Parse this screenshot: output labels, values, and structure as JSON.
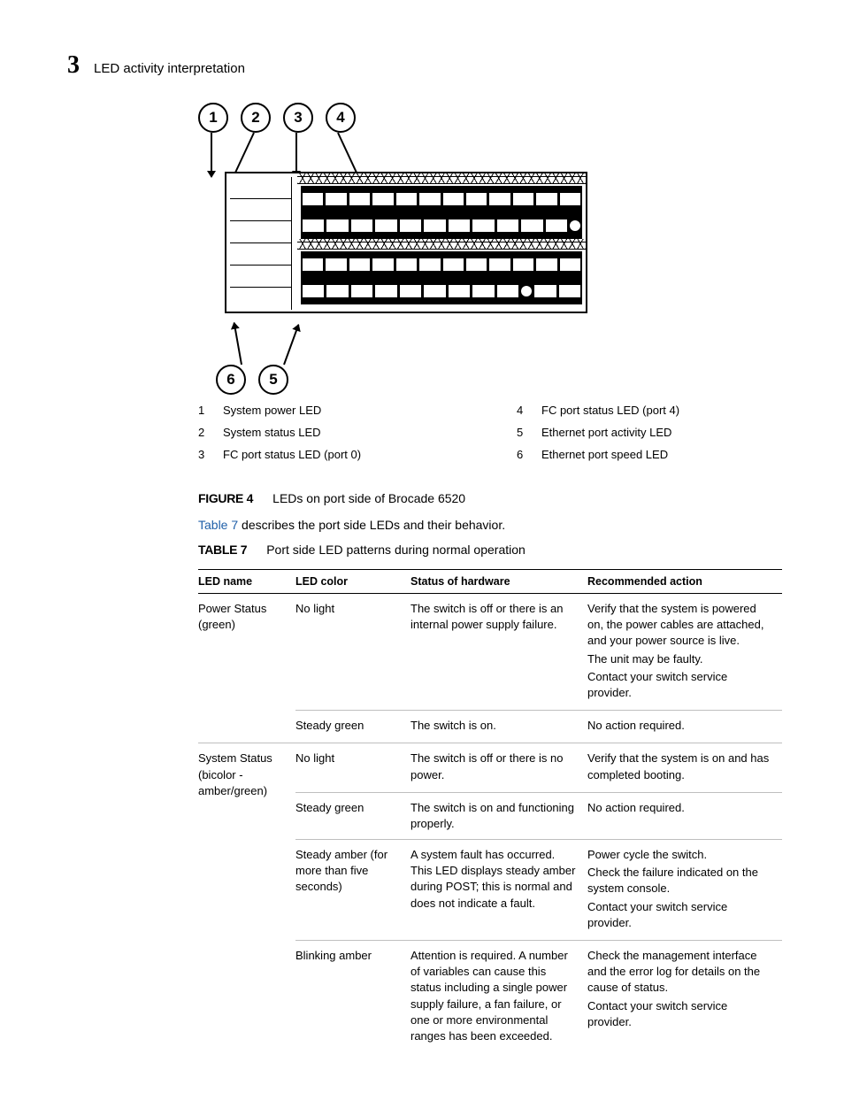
{
  "header": {
    "chapter_number": "3",
    "section_title": "LED activity interpretation"
  },
  "diagram": {
    "callouts_top": [
      "1",
      "2",
      "3",
      "4"
    ],
    "callouts_bottom": [
      "6",
      "5"
    ]
  },
  "legend": {
    "left": [
      {
        "num": "1",
        "text": "System power LED"
      },
      {
        "num": "2",
        "text": "System status LED"
      },
      {
        "num": "3",
        "text": "FC port status LED (port 0)"
      }
    ],
    "right": [
      {
        "num": "4",
        "text": "FC port status LED (port 4)"
      },
      {
        "num": "5",
        "text": "Ethernet port activity LED"
      },
      {
        "num": "6",
        "text": "Ethernet port speed LED"
      }
    ]
  },
  "figure": {
    "label": "FIGURE 4",
    "caption": "LEDs on port side of Brocade 6520"
  },
  "intro_para": {
    "link_text": "Table 7",
    "rest": " describes the port side LEDs and their behavior."
  },
  "table": {
    "label": "TABLE 7",
    "caption": "Port side LED patterns during normal operation",
    "headers": {
      "name": "LED name",
      "color": "LED color",
      "hw": "Status of hardware",
      "rec": "Recommended action"
    },
    "rows": [
      {
        "name": "Power Status (green)",
        "states": [
          {
            "color": "No light",
            "hw": "The switch is off or there is an internal power supply failure.",
            "rec": [
              "Verify that the system is powered on, the power cables are attached, and your power source is live.",
              "The unit may be faulty.",
              "Contact your switch service provider."
            ]
          },
          {
            "color": "Steady green",
            "hw": "The switch is on.",
            "rec": [
              "No action required."
            ]
          }
        ]
      },
      {
        "name": "System Status (bicolor - amber/green)",
        "states": [
          {
            "color": "No light",
            "hw": "The switch is off or there is no power.",
            "rec": [
              "Verify that the system is on and has completed booting."
            ]
          },
          {
            "color": "Steady green",
            "hw": "The switch is on and functioning properly.",
            "rec": [
              "No action required."
            ]
          },
          {
            "color": "Steady amber (for more than five seconds)",
            "hw": "A system fault has occurred. This LED displays steady amber during POST; this is normal and does not indicate a fault.",
            "rec": [
              "Power cycle the switch.",
              "Check the failure indicated on the system console.",
              "Contact your switch service provider."
            ]
          },
          {
            "color": "Blinking amber",
            "hw": "Attention is required. A number of variables can cause this status including a single power supply failure, a fan failure, or one or more environmental ranges has been exceeded.",
            "rec": [
              "Check the management interface and the error log for details on the cause of status.",
              "Contact your switch service provider."
            ]
          }
        ]
      }
    ]
  }
}
